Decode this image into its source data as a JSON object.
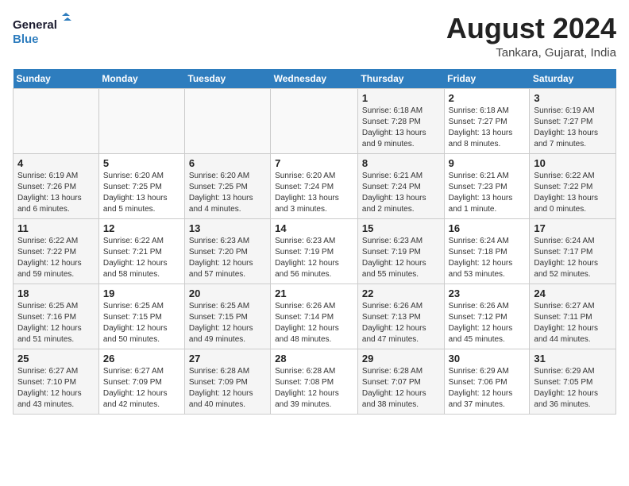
{
  "header": {
    "logo_line1": "General",
    "logo_line2": "Blue",
    "month_year": "August 2024",
    "location": "Tankara, Gujarat, India"
  },
  "weekdays": [
    "Sunday",
    "Monday",
    "Tuesday",
    "Wednesday",
    "Thursday",
    "Friday",
    "Saturday"
  ],
  "weeks": [
    [
      {
        "day": "",
        "info": ""
      },
      {
        "day": "",
        "info": ""
      },
      {
        "day": "",
        "info": ""
      },
      {
        "day": "",
        "info": ""
      },
      {
        "day": "1",
        "info": "Sunrise: 6:18 AM\nSunset: 7:28 PM\nDaylight: 13 hours and 9 minutes."
      },
      {
        "day": "2",
        "info": "Sunrise: 6:18 AM\nSunset: 7:27 PM\nDaylight: 13 hours and 8 minutes."
      },
      {
        "day": "3",
        "info": "Sunrise: 6:19 AM\nSunset: 7:27 PM\nDaylight: 13 hours and 7 minutes."
      }
    ],
    [
      {
        "day": "4",
        "info": "Sunrise: 6:19 AM\nSunset: 7:26 PM\nDaylight: 13 hours and 6 minutes."
      },
      {
        "day": "5",
        "info": "Sunrise: 6:20 AM\nSunset: 7:25 PM\nDaylight: 13 hours and 5 minutes."
      },
      {
        "day": "6",
        "info": "Sunrise: 6:20 AM\nSunset: 7:25 PM\nDaylight: 13 hours and 4 minutes."
      },
      {
        "day": "7",
        "info": "Sunrise: 6:20 AM\nSunset: 7:24 PM\nDaylight: 13 hours and 3 minutes."
      },
      {
        "day": "8",
        "info": "Sunrise: 6:21 AM\nSunset: 7:24 PM\nDaylight: 13 hours and 2 minutes."
      },
      {
        "day": "9",
        "info": "Sunrise: 6:21 AM\nSunset: 7:23 PM\nDaylight: 13 hours and 1 minute."
      },
      {
        "day": "10",
        "info": "Sunrise: 6:22 AM\nSunset: 7:22 PM\nDaylight: 13 hours and 0 minutes."
      }
    ],
    [
      {
        "day": "11",
        "info": "Sunrise: 6:22 AM\nSunset: 7:22 PM\nDaylight: 12 hours and 59 minutes."
      },
      {
        "day": "12",
        "info": "Sunrise: 6:22 AM\nSunset: 7:21 PM\nDaylight: 12 hours and 58 minutes."
      },
      {
        "day": "13",
        "info": "Sunrise: 6:23 AM\nSunset: 7:20 PM\nDaylight: 12 hours and 57 minutes."
      },
      {
        "day": "14",
        "info": "Sunrise: 6:23 AM\nSunset: 7:19 PM\nDaylight: 12 hours and 56 minutes."
      },
      {
        "day": "15",
        "info": "Sunrise: 6:23 AM\nSunset: 7:19 PM\nDaylight: 12 hours and 55 minutes."
      },
      {
        "day": "16",
        "info": "Sunrise: 6:24 AM\nSunset: 7:18 PM\nDaylight: 12 hours and 53 minutes."
      },
      {
        "day": "17",
        "info": "Sunrise: 6:24 AM\nSunset: 7:17 PM\nDaylight: 12 hours and 52 minutes."
      }
    ],
    [
      {
        "day": "18",
        "info": "Sunrise: 6:25 AM\nSunset: 7:16 PM\nDaylight: 12 hours and 51 minutes."
      },
      {
        "day": "19",
        "info": "Sunrise: 6:25 AM\nSunset: 7:15 PM\nDaylight: 12 hours and 50 minutes."
      },
      {
        "day": "20",
        "info": "Sunrise: 6:25 AM\nSunset: 7:15 PM\nDaylight: 12 hours and 49 minutes."
      },
      {
        "day": "21",
        "info": "Sunrise: 6:26 AM\nSunset: 7:14 PM\nDaylight: 12 hours and 48 minutes."
      },
      {
        "day": "22",
        "info": "Sunrise: 6:26 AM\nSunset: 7:13 PM\nDaylight: 12 hours and 47 minutes."
      },
      {
        "day": "23",
        "info": "Sunrise: 6:26 AM\nSunset: 7:12 PM\nDaylight: 12 hours and 45 minutes."
      },
      {
        "day": "24",
        "info": "Sunrise: 6:27 AM\nSunset: 7:11 PM\nDaylight: 12 hours and 44 minutes."
      }
    ],
    [
      {
        "day": "25",
        "info": "Sunrise: 6:27 AM\nSunset: 7:10 PM\nDaylight: 12 hours and 43 minutes."
      },
      {
        "day": "26",
        "info": "Sunrise: 6:27 AM\nSunset: 7:09 PM\nDaylight: 12 hours and 42 minutes."
      },
      {
        "day": "27",
        "info": "Sunrise: 6:28 AM\nSunset: 7:09 PM\nDaylight: 12 hours and 40 minutes."
      },
      {
        "day": "28",
        "info": "Sunrise: 6:28 AM\nSunset: 7:08 PM\nDaylight: 12 hours and 39 minutes."
      },
      {
        "day": "29",
        "info": "Sunrise: 6:28 AM\nSunset: 7:07 PM\nDaylight: 12 hours and 38 minutes."
      },
      {
        "day": "30",
        "info": "Sunrise: 6:29 AM\nSunset: 7:06 PM\nDaylight: 12 hours and 37 minutes."
      },
      {
        "day": "31",
        "info": "Sunrise: 6:29 AM\nSunset: 7:05 PM\nDaylight: 12 hours and 36 minutes."
      }
    ]
  ]
}
